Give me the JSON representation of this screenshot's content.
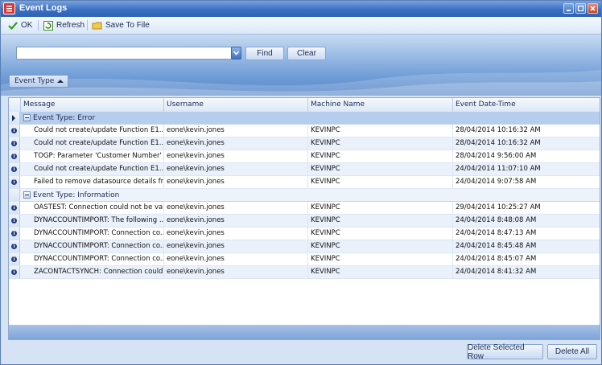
{
  "window": {
    "title": "Event Logs"
  },
  "toolbar": {
    "ok_label": "OK",
    "refresh_label": "Refresh",
    "save_label": "Save To File"
  },
  "search": {
    "value": "",
    "placeholder": "",
    "find_label": "Find",
    "clear_label": "Clear"
  },
  "group_chip": {
    "label": "Event Type"
  },
  "columns": [
    "Message",
    "Username",
    "Machine Name",
    "Event Date-Time"
  ],
  "groups": [
    {
      "label": "Event Type: Error",
      "rows": [
        {
          "message": "Could not create/update Function E1...",
          "username": "eone\\kevin.jones",
          "machine": "KEVINPC",
          "datetime": "28/04/2014 10:16:32 AM"
        },
        {
          "message": "Could not create/update Function E1...",
          "username": "eone\\kevin.jones",
          "machine": "KEVINPC",
          "datetime": "28/04/2014 10:16:32 AM"
        },
        {
          "message": "TOGP: Parameter 'Customer Number' i...",
          "username": "eone\\kevin.jones",
          "machine": "KEVINPC",
          "datetime": "28/04/2014 9:56:00 AM"
        },
        {
          "message": "Could not create/update Function E1...",
          "username": "eone\\kevin.jones",
          "machine": "KEVINPC",
          "datetime": "24/04/2014 11:07:10 AM"
        },
        {
          "message": "Failed to remove datasource details fr...",
          "username": "eone\\kevin.jones",
          "machine": "KEVINPC",
          "datetime": "24/04/2014 9:07:58 AM"
        }
      ]
    },
    {
      "label": "Event Type: Information",
      "rows": [
        {
          "message": "OASTEST: Connection could not be va...",
          "username": "eone\\kevin.jones",
          "machine": "KEVINPC",
          "datetime": "29/04/2014 10:25:27 AM"
        },
        {
          "message": "DYNACCOUNTIMPORT: The following ...",
          "username": "eone\\kevin.jones",
          "machine": "KEVINPC",
          "datetime": "24/04/2014 8:48:08 AM"
        },
        {
          "message": "DYNACCOUNTIMPORT: Connection co...",
          "username": "eone\\kevin.jones",
          "machine": "KEVINPC",
          "datetime": "24/04/2014 8:47:13 AM"
        },
        {
          "message": "DYNACCOUNTIMPORT: Connection co...",
          "username": "eone\\kevin.jones",
          "machine": "KEVINPC",
          "datetime": "24/04/2014 8:45:48 AM"
        },
        {
          "message": "DYNACCOUNTIMPORT: Connection co...",
          "username": "eone\\kevin.jones",
          "machine": "KEVINPC",
          "datetime": "24/04/2014 8:45:07 AM"
        },
        {
          "message": "ZACONTACTSYNCH: Connection could...",
          "username": "eone\\kevin.jones",
          "machine": "KEVINPC",
          "datetime": "24/04/2014 8:41:32 AM"
        }
      ]
    }
  ],
  "footer": {
    "delete_selected_label": "Delete Selected Row",
    "delete_all_label": "Delete All"
  }
}
